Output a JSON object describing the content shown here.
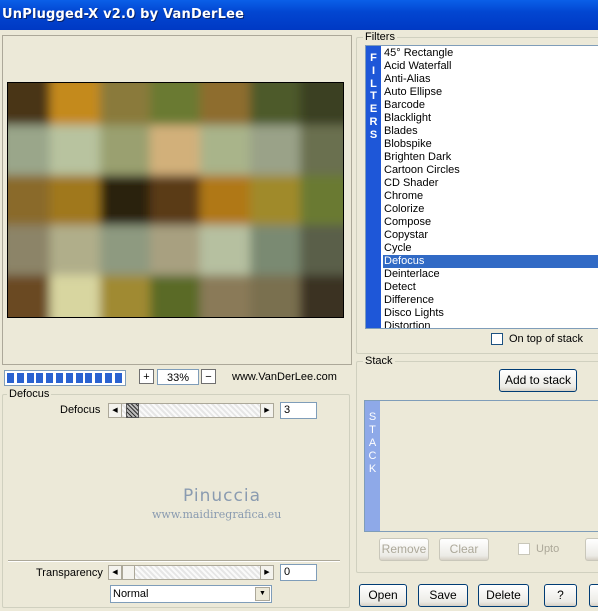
{
  "window": {
    "title": "UnPlugged-X v2.0 by VanDerLee"
  },
  "zoom": {
    "value": "33%",
    "plus": "+",
    "minus": "−",
    "website": "www.VanDerLee.com",
    "progress_segments": 12
  },
  "defocus_group": {
    "title": "Defocus",
    "slider_label": "Defocus",
    "slider_value": "3",
    "slider_fraction": 0.03
  },
  "transparency": {
    "label": "Transparency",
    "value": "0",
    "fraction": 0.0
  },
  "blend_mode": {
    "selected": "Normal"
  },
  "watermark": {
    "name": "Pinuccia",
    "url": "www.maidiregrafica.eu"
  },
  "filters": {
    "title": "Filters",
    "vertical_label": [
      "F",
      "I",
      "L",
      "T",
      "E",
      "R",
      "S"
    ],
    "items": [
      "45° Rectangle",
      "Acid Waterfall",
      "Anti-Alias",
      "Auto Ellipse",
      "Barcode",
      "Blacklight",
      "Blades",
      "Blobspike",
      "Brighten Dark",
      "Cartoon Circles",
      "CD Shader",
      "Chrome",
      "Colorize",
      "Compose",
      "Copystar",
      "Cycle",
      "Defocus",
      "Deinterlace",
      "Detect",
      "Difference",
      "Disco Lights",
      "Distortion"
    ],
    "selected_index": 16,
    "on_top_label": "On top of stack"
  },
  "stack": {
    "title": "Stack",
    "add_label": "Add to stack",
    "vertical_label": [
      "S",
      "T",
      "A",
      "C",
      "K"
    ],
    "remove_label": "Remove",
    "clear_label": "Clear",
    "upto_label": "Upto"
  },
  "buttons": {
    "open": "Open",
    "save": "Save",
    "delete": "Delete",
    "help": "?"
  },
  "colors": {
    "accent": "#316ac5",
    "titlebar": "#0046d5",
    "filters_strip": "#1e57d8",
    "stack_strip": "#8ea9e8"
  }
}
